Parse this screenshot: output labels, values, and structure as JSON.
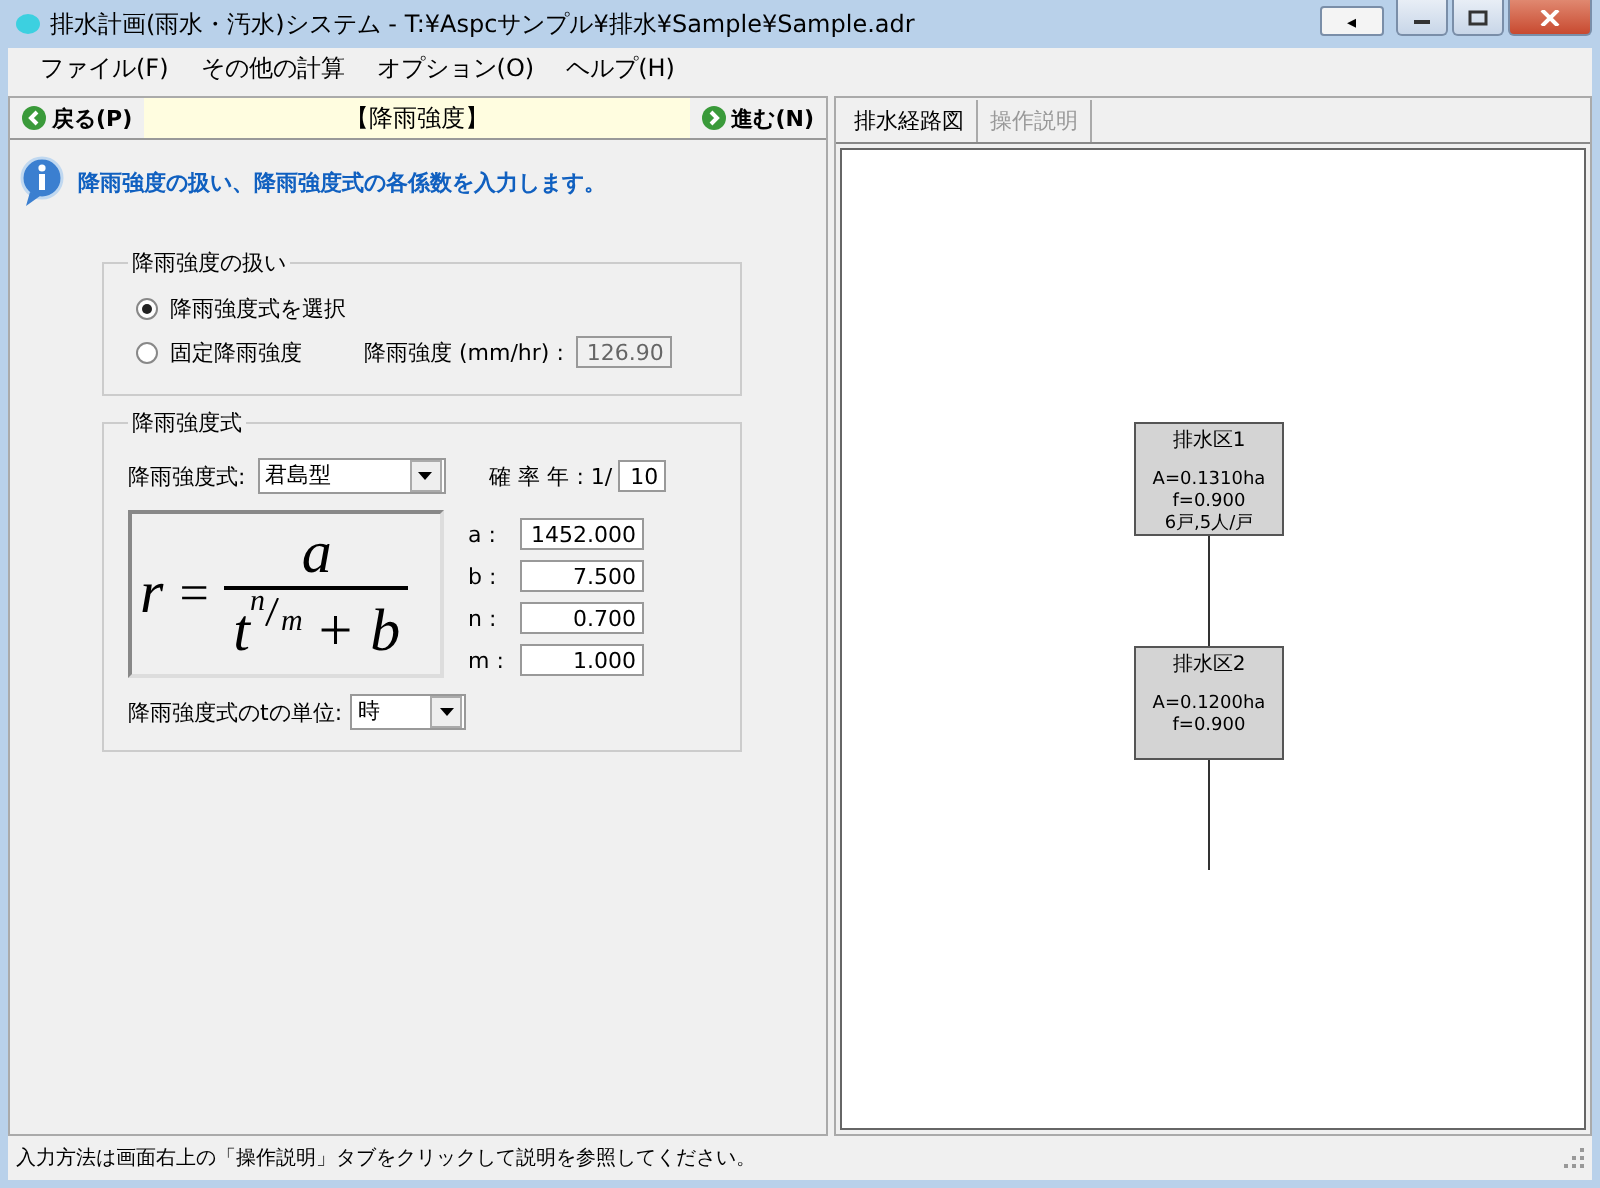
{
  "window": {
    "title": "排水計画(雨水・汚水)システム - T:¥Aspcサンプル¥排水¥Sample¥Sample.adr",
    "extra_button": "◂"
  },
  "menu": [
    "ファイル(F)",
    "その他の計算",
    "オプション(O)",
    "ヘルプ(H)"
  ],
  "nav": {
    "back": "戻る(P)",
    "title": "【降雨強度】",
    "next": "進む(N)"
  },
  "info": "降雨強度の扱い、降雨強度式の各係数を入力します。",
  "handling": {
    "legend": "降雨強度の扱い",
    "options": [
      {
        "label": "降雨強度式を選択",
        "selected": true
      },
      {
        "label": "固定降雨強度",
        "selected": false
      }
    ],
    "intensity_label": "降雨強度 (mm/hr) :",
    "intensity_value": "126.90"
  },
  "formula_group": {
    "legend": "降雨強度式",
    "type_label": "降雨強度式:",
    "type_value": "君島型",
    "prob_label": "確 率 年 : 1/",
    "prob_value": "10",
    "formula": {
      "lhs": "r",
      "eq": "=",
      "numerator": "a",
      "base": "t",
      "exp_n": "n",
      "exp_m": "m",
      "plus": "+ b"
    },
    "coefficients": [
      {
        "label": "a :",
        "value": "1452.000"
      },
      {
        "label": "b :",
        "value": "7.500"
      },
      {
        "label": "n :",
        "value": "0.700"
      },
      {
        "label": "m :",
        "value": "1.000"
      }
    ],
    "unit_label": "降雨強度式のtの単位:",
    "unit_value": "時"
  },
  "tabs": [
    {
      "label": "排水経路図",
      "selected": true
    },
    {
      "label": "操作説明",
      "selected": false
    }
  ],
  "diagram": {
    "nodes": [
      {
        "title": "排水区1",
        "lines": [
          "A=0.1310ha",
          "f=0.900",
          "6戸,5人/戸"
        ]
      },
      {
        "title": "排水区2",
        "lines": [
          "A=0.1200ha",
          "f=0.900"
        ]
      }
    ]
  },
  "status_bar": "入力方法は画面右上の「操作説明」タブをクリックして説明を参照してください。"
}
